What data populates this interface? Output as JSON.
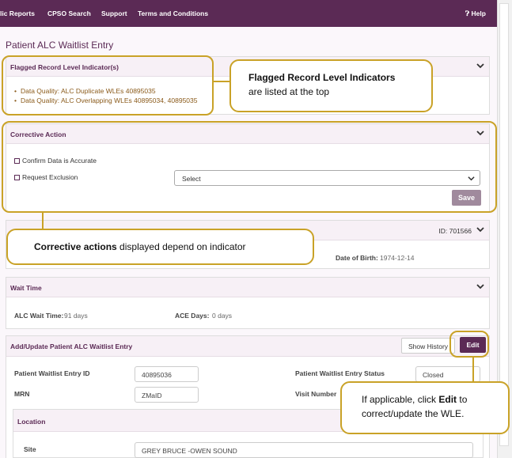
{
  "nav": {
    "items": [
      "lic Reports",
      "CPSO Search",
      "Support",
      "Terms and Conditions"
    ],
    "help": "Help"
  },
  "page_title": "Patient ALC Waitlist Entry",
  "flagged": {
    "title": "Flagged Record Level Indicator(s)",
    "items": [
      "Data Quality: ALC Duplicate WLEs 40895035",
      "Data Quality: ALC Overlapping WLEs 40895034, 40895035"
    ]
  },
  "corrective": {
    "title": "Corrective Action",
    "confirm_label": "Confirm Data is Accurate",
    "exclusion_label": "Request Exclusion",
    "select_value": "Select",
    "save_label": "Save"
  },
  "patient": {
    "id_label": "ID: 701566",
    "dob_label": "Date of Birth:",
    "dob_value": "1974-12-14"
  },
  "wait_time": {
    "title": "Wait Time",
    "alc_label": "ALC Wait Time:",
    "alc_value": "91 days",
    "ace_label": "ACE Days:",
    "ace_value": "0 days"
  },
  "add_update": {
    "title": "Add/Update Patient ALC Waitlist Entry",
    "show_history": "Show History",
    "edit": "Edit",
    "entry_id_label": "Patient Waitlist Entry ID",
    "entry_id_value": "40895036",
    "status_label": "Patient Waitlist Entry Status",
    "status_value": "Closed",
    "mrn_label": "MRN",
    "mrn_value": "ZMaID",
    "visit_label": "Visit Number",
    "location_title": "Location",
    "site_label": "Site",
    "site_value": "GREY BRUCE -OWEN SOUND"
  },
  "callouts": {
    "flagged_bold": "Flagged Record Level Indicators",
    "flagged_rest": "are listed at the top",
    "corrective_bold": "Corrective actions",
    "corrective_rest": " displayed depend on indicator",
    "edit_pre": "If applicable, click ",
    "edit_bold": "Edit",
    "edit_post": " to",
    "edit_line2": "correct/update  the WLE."
  },
  "colors": {
    "brand": "#5b2a55",
    "callout_border": "#c9a227",
    "flag_text": "#8a5a1a"
  }
}
